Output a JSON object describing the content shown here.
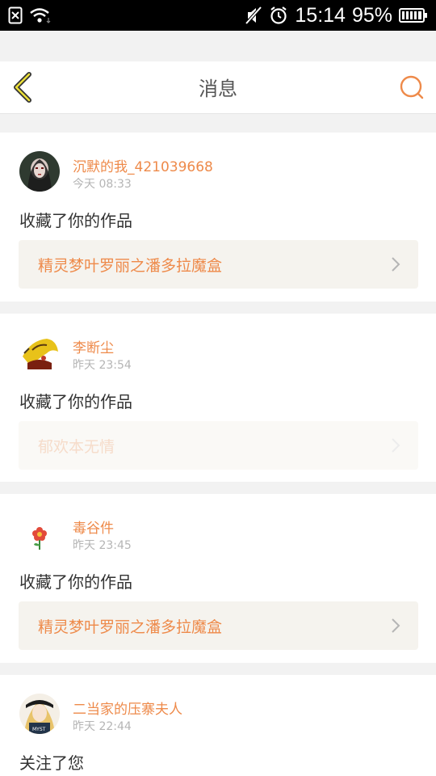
{
  "status_bar": {
    "time": "15:14",
    "battery": "95%"
  },
  "nav": {
    "title": "消息"
  },
  "accent_color": "#ee8a4a",
  "messages": [
    {
      "username": "沉默的我_421039668",
      "time": "今天 08:33",
      "action": "收藏了你的作品",
      "work_title": "精灵梦叶罗丽之潘多拉魔盒"
    },
    {
      "username": "李断尘",
      "time": "昨天 23:54",
      "action": "收藏了你的作品",
      "work_title": "郁欢本无情"
    },
    {
      "username": "毒谷件",
      "time": "昨天 23:45",
      "action": "收藏了你的作品",
      "work_title": "精灵梦叶罗丽之潘多拉魔盒"
    },
    {
      "username": "二当家的压寨夫人",
      "time": "昨天 22:44",
      "action": "关注了您"
    }
  ]
}
